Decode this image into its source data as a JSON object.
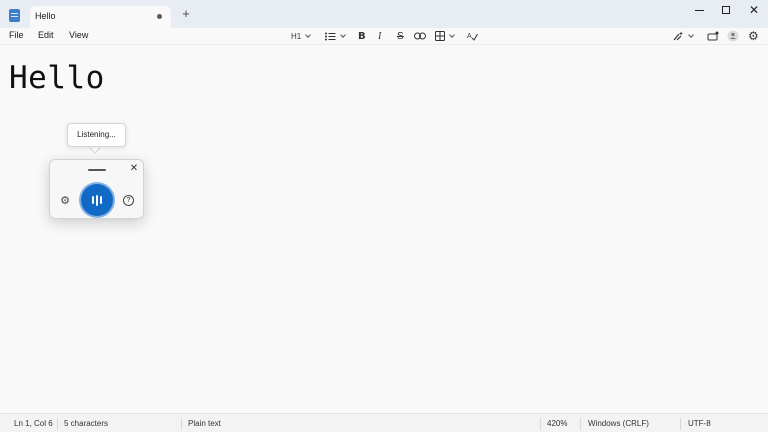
{
  "tab": {
    "title": "Hello",
    "new_tab": "+"
  },
  "window": {
    "minimize": "—",
    "maximize": "□",
    "close": "✕"
  },
  "menu": {
    "file": "File",
    "edit": "Edit",
    "view": "View"
  },
  "toolbar": {
    "heading": "H1",
    "bold": "B",
    "italic": "I",
    "strikethrough": "S",
    "icons": [
      "list-icon",
      "link-icon",
      "table-icon",
      "spellcheck-icon",
      "copilot-icon",
      "share-icon",
      "account-icon",
      "gear-icon"
    ]
  },
  "editor": {
    "content": "Hello"
  },
  "voice_typing": {
    "tooltip": "Listening...",
    "close": "✕",
    "settings": "⚙",
    "help": "?",
    "accent": "#1169c6"
  },
  "status": {
    "position": "Ln 1, Col 6",
    "characters": "5 characters",
    "format": "Plain text",
    "zoom": "420%",
    "line_ending": "Windows (CRLF)",
    "encoding": "UTF-8"
  }
}
